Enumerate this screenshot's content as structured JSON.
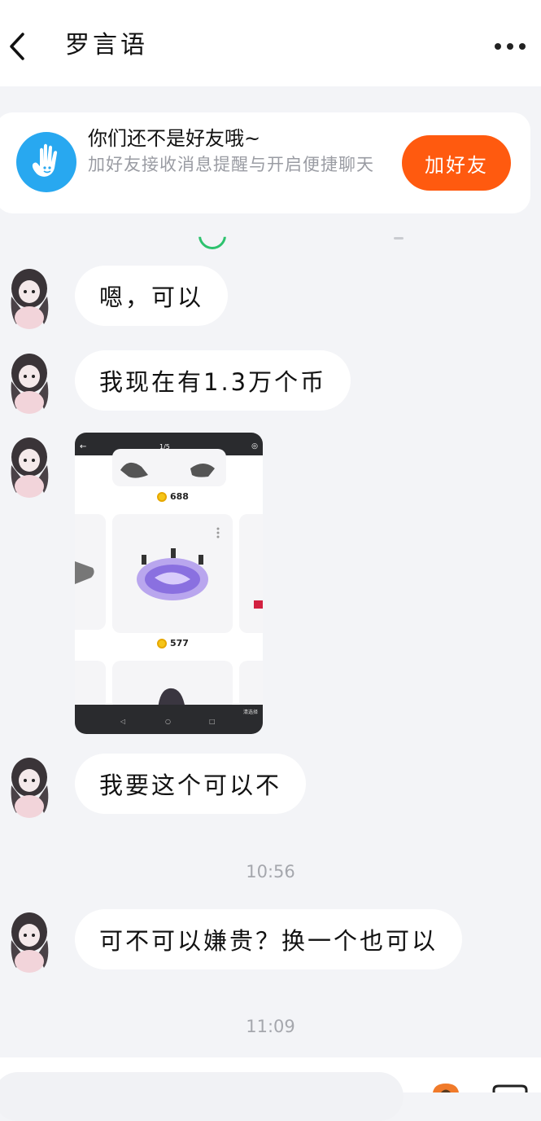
{
  "header": {
    "title": "罗言语"
  },
  "banner": {
    "title": "你们还不是好友哦~",
    "subtitle": "加好友接收消息提醒与开启便捷聊天",
    "add_button": "加好友"
  },
  "messages": [
    {
      "type": "text",
      "text": "嗯，可以"
    },
    {
      "type": "text",
      "text": "我现在有1.3万个币"
    },
    {
      "type": "image",
      "caption_page": "1/5",
      "prices": [
        "688",
        "577"
      ],
      "footer_hint": "清选择"
    },
    {
      "type": "text",
      "text": "我要这个可以不"
    },
    {
      "type": "time",
      "text": "10:56"
    },
    {
      "type": "text",
      "text": "可不可以嫌贵？换一个也可以"
    },
    {
      "type": "time",
      "text": "11:09"
    }
  ],
  "colors": {
    "accent": "#ff5a0f",
    "banner_icon": "#28a8f0",
    "background": "#f3f4f7"
  }
}
